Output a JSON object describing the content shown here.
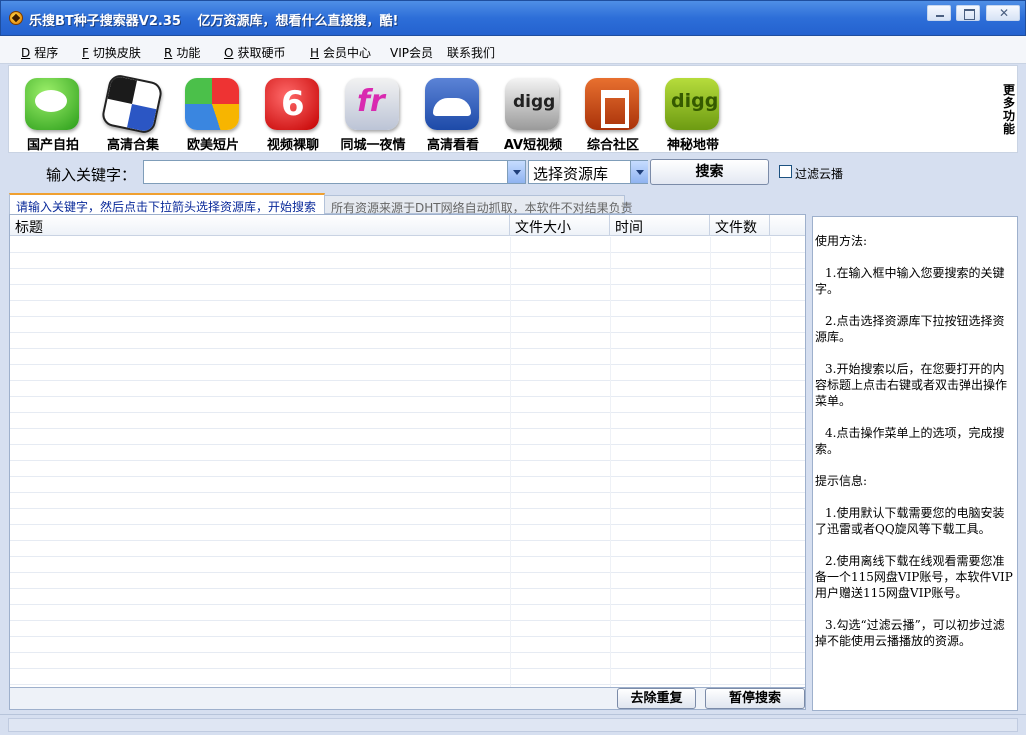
{
  "window": {
    "title": "乐搜BT种子搜索器V2.35",
    "slogan": "亿万资源库，想看什么直接搜，酷!",
    "controls": [
      "minimize",
      "maximize",
      "close"
    ],
    "close_glyph": "✕"
  },
  "menu": [
    {
      "key": "D",
      "label": "程序"
    },
    {
      "key": "F",
      "label": "切换皮肤"
    },
    {
      "key": "R",
      "label": "功能"
    },
    {
      "key": "O",
      "label": "获取硬币"
    },
    {
      "key": "H",
      "label": "会员中心"
    },
    {
      "key": "",
      "label": "VIP会员"
    },
    {
      "key": "",
      "label": "联系我们"
    }
  ],
  "toolbar": {
    "items": [
      {
        "label": "国产自拍",
        "icon": "green-chat-icon"
      },
      {
        "label": "高清合集",
        "icon": "delicious-icon"
      },
      {
        "label": "欧美短片",
        "icon": "pie-chart-icon"
      },
      {
        "label": "视频裸聊",
        "icon": "red-six-icon"
      },
      {
        "label": "同城一夜情",
        "icon": "flickr-fr-icon"
      },
      {
        "label": "高清看看",
        "icon": "people-group-icon"
      },
      {
        "label": "AV短视频",
        "icon": "digg-gray-icon"
      },
      {
        "label": "综合社区",
        "icon": "orange-community-icon"
      },
      {
        "label": "神秘地带",
        "icon": "digg-green-icon"
      }
    ],
    "more_label": "更多功能"
  },
  "search": {
    "keyword_label": "输入关键字：",
    "keyword_value": "",
    "library_value": "选择资源库",
    "search_button": "搜索",
    "filter_label": "过滤云播",
    "filter_checked": false
  },
  "tabs": [
    {
      "label": "请输入关键字，然后点击下拉箭头选择资源库，开始搜索",
      "active": true
    },
    {
      "label": "所有资源来源于DHT网络自动抓取，本软件不对结果负责",
      "active": false
    }
  ],
  "results": {
    "columns": [
      "标题",
      "文件大小",
      "时间",
      "文件数"
    ],
    "rows": []
  },
  "actions": {
    "dedupe": "去除重复",
    "pause": "暂停搜索"
  },
  "help": {
    "usage_title": "使用方法:",
    "steps": [
      "1.在输入框中输入您要搜索的关键字。",
      "2.点击选择资源库下拉按钮选择资源库。",
      "3.开始搜索以后，在您要打开的内容标题上点击右键或者双击弹出操作菜单。",
      "4.点击操作菜单上的选项，完成搜索。"
    ],
    "tips_title": "提示信息:",
    "tips": [
      "1.使用默认下载需要您的电脑安装了迅雷或者QQ旋风等下载工具。",
      "2.使用离线下载在线观看需要您准备一个115网盘VIP账号，本软件VIP用户赠送115网盘VIP账号。",
      "3.勾选“过滤云播”，可以初步过滤掉不能使用云播播放的资源。"
    ]
  }
}
